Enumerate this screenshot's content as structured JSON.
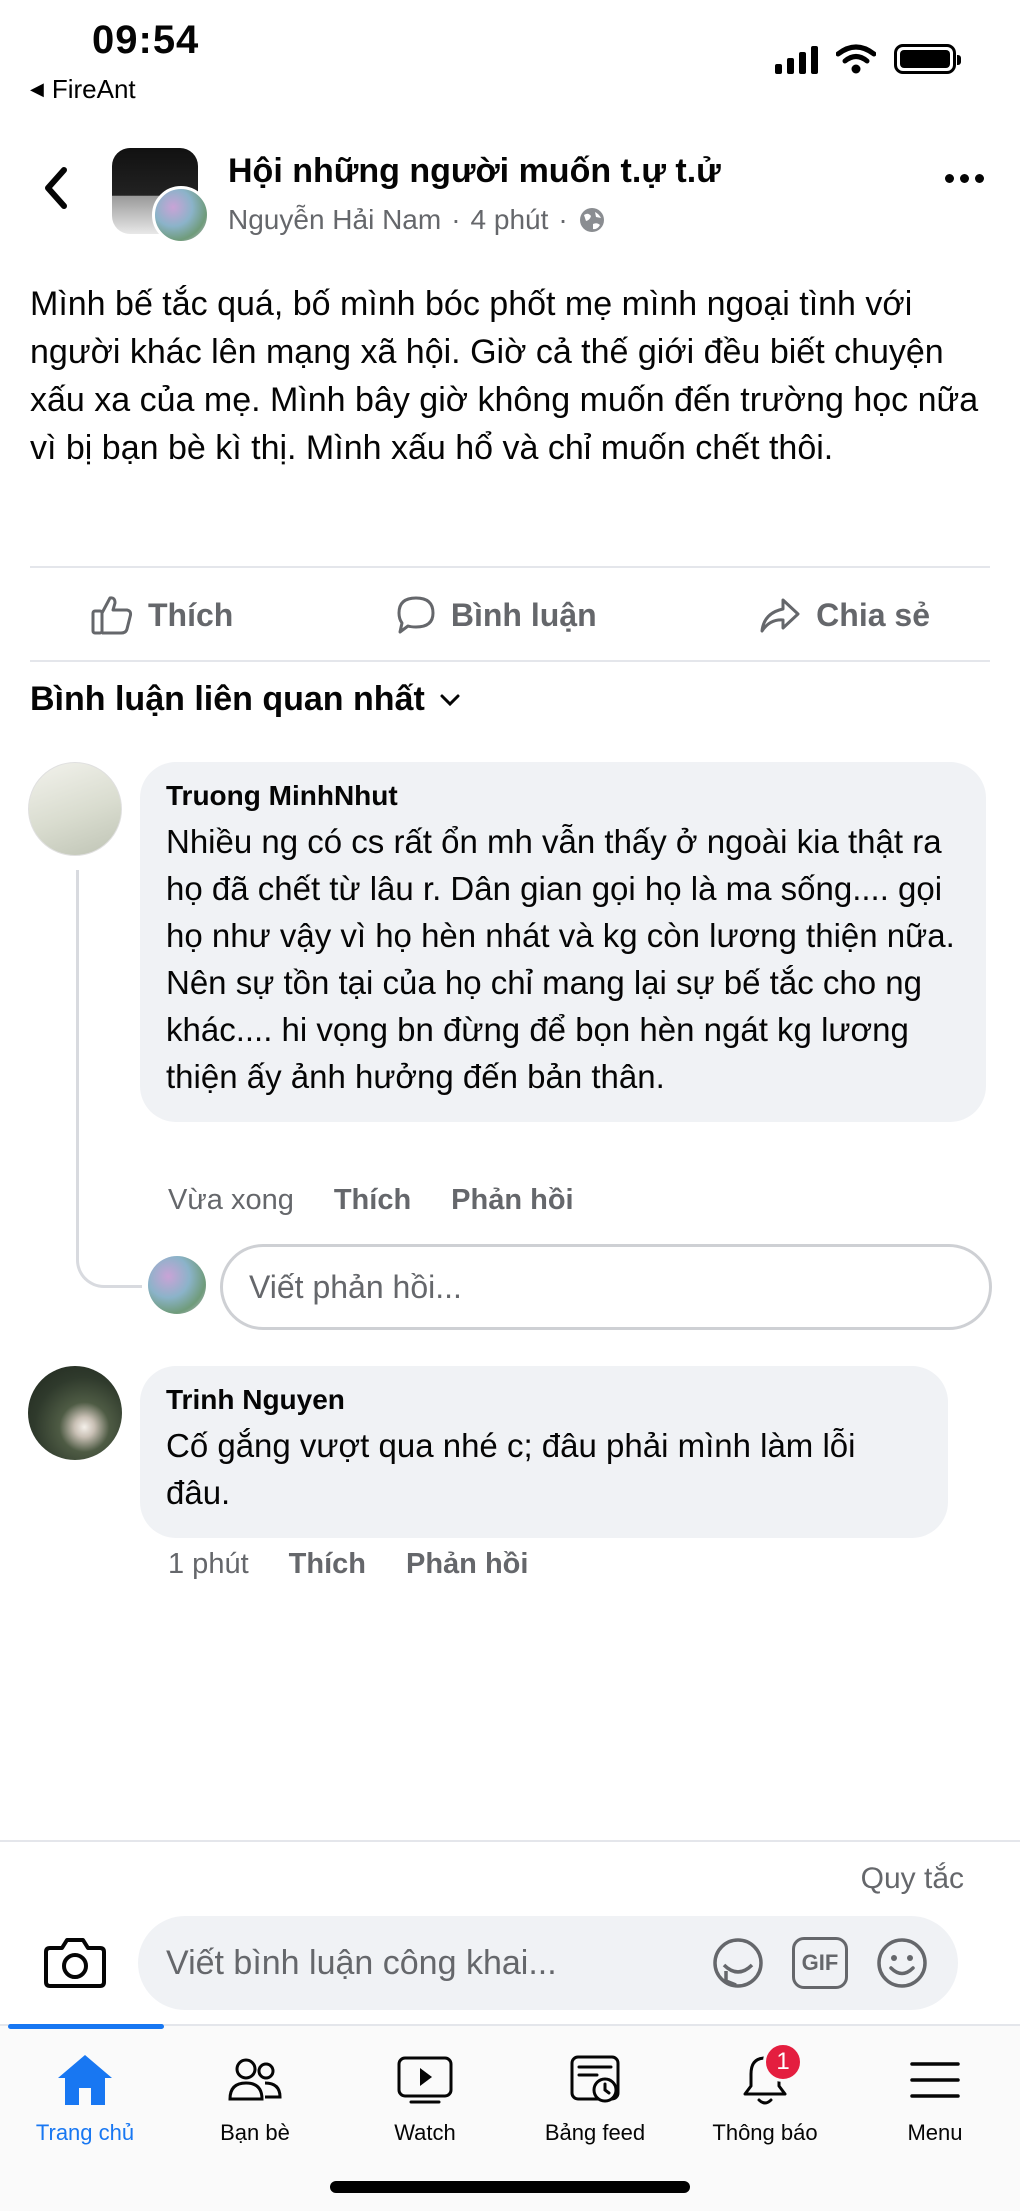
{
  "status_bar": {
    "time": "09:54",
    "back_app": "FireAnt"
  },
  "post": {
    "group_name": "Hội những người muốn t.ự t.ử",
    "author": "Nguyễn Hải Nam",
    "separator": "·",
    "time": "4 phút",
    "body": "Mình bế tắc quá, bố mình bóc phốt mẹ mình ngoại tình với người khác lên mạng xã hội. Giờ cả thế giới đều biết chuyện xấu xa của mẹ. Mình bây giờ không muốn đến trường học nữa vì bị bạn bè kì thị. Mình xấu hổ và chỉ muốn chết thôi."
  },
  "actions": {
    "like": "Thích",
    "comment": "Bình luận",
    "share": "Chia sẻ"
  },
  "comments_sort": "Bình luận liên quan nhất",
  "comments": [
    {
      "author": "Truong MinhNhut",
      "text": "Nhiều ng có cs rất ổn mh vẫn thấy ở ngoài kia thật ra họ đã chết từ lâu r. Dân gian gọi họ là ma sống....   gọi họ như vậy vì họ hèn nhát và kg còn lương thiện nữa. Nên sự tồn tại của họ chỉ mang lại sự bế tắc cho ng khác.... hi vọng bn đừng để bọn hèn ngát kg lương thiện ấy ảnh hưởng đến bản thân.",
      "time": "Vừa xong",
      "like": "Thích",
      "reply": "Phản hồi"
    },
    {
      "author": "Trinh Nguyen",
      "text": "Cố gắng vượt qua nhé c; đâu phải mình làm lỗi đâu.",
      "time": "1 phút",
      "like": "Thích",
      "reply": "Phản hồi"
    }
  ],
  "reply_placeholder": "Viết phản hồi...",
  "rules": "Quy tắc",
  "compose_placeholder": "Viết bình luận công khai...",
  "gif_label": "GIF",
  "tabs": [
    {
      "label": "Trang chủ",
      "icon": "home-icon"
    },
    {
      "label": "Bạn bè",
      "icon": "friends-icon"
    },
    {
      "label": "Watch",
      "icon": "watch-icon"
    },
    {
      "label": "Bảng feed",
      "icon": "feed-icon"
    },
    {
      "label": "Thông báo",
      "icon": "bell-icon",
      "badge": "1"
    },
    {
      "label": "Menu",
      "icon": "menu-icon"
    }
  ],
  "colors": {
    "accent": "#1877f2",
    "bubble": "#f0f2f5",
    "muted": "#65676b",
    "badge": "#e41e3f"
  }
}
